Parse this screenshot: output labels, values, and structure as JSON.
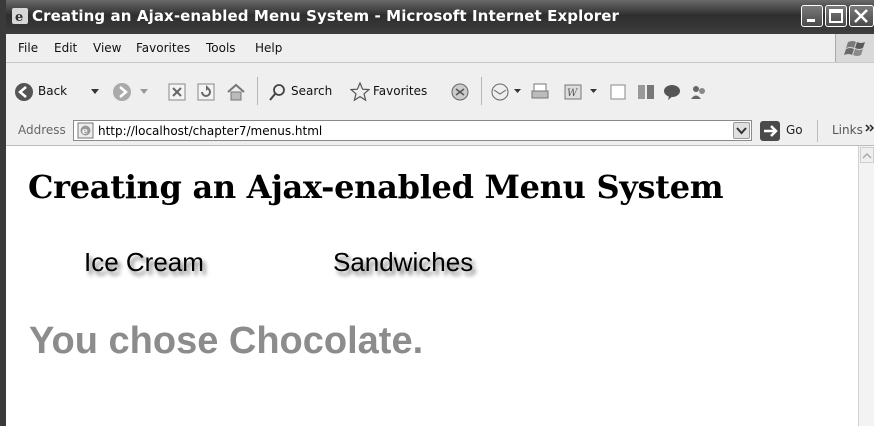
{
  "window": {
    "title": "Creating an Ajax-enabled Menu System - Microsoft Internet Explorer"
  },
  "menubar": {
    "items": [
      "File",
      "Edit",
      "View",
      "Favorites",
      "Tools",
      "Help"
    ]
  },
  "toolbar": {
    "back_label": "Back",
    "search_label": "Search",
    "favorites_label": "Favorites"
  },
  "address": {
    "label": "Address",
    "url": "http://localhost/chapter7/menus.html",
    "go_label": "Go",
    "links_label": "Links"
  },
  "page": {
    "heading": "Creating an Ajax-enabled Menu System",
    "menus": [
      "Ice Cream",
      "Sandwiches"
    ],
    "result": "You chose Chocolate."
  }
}
